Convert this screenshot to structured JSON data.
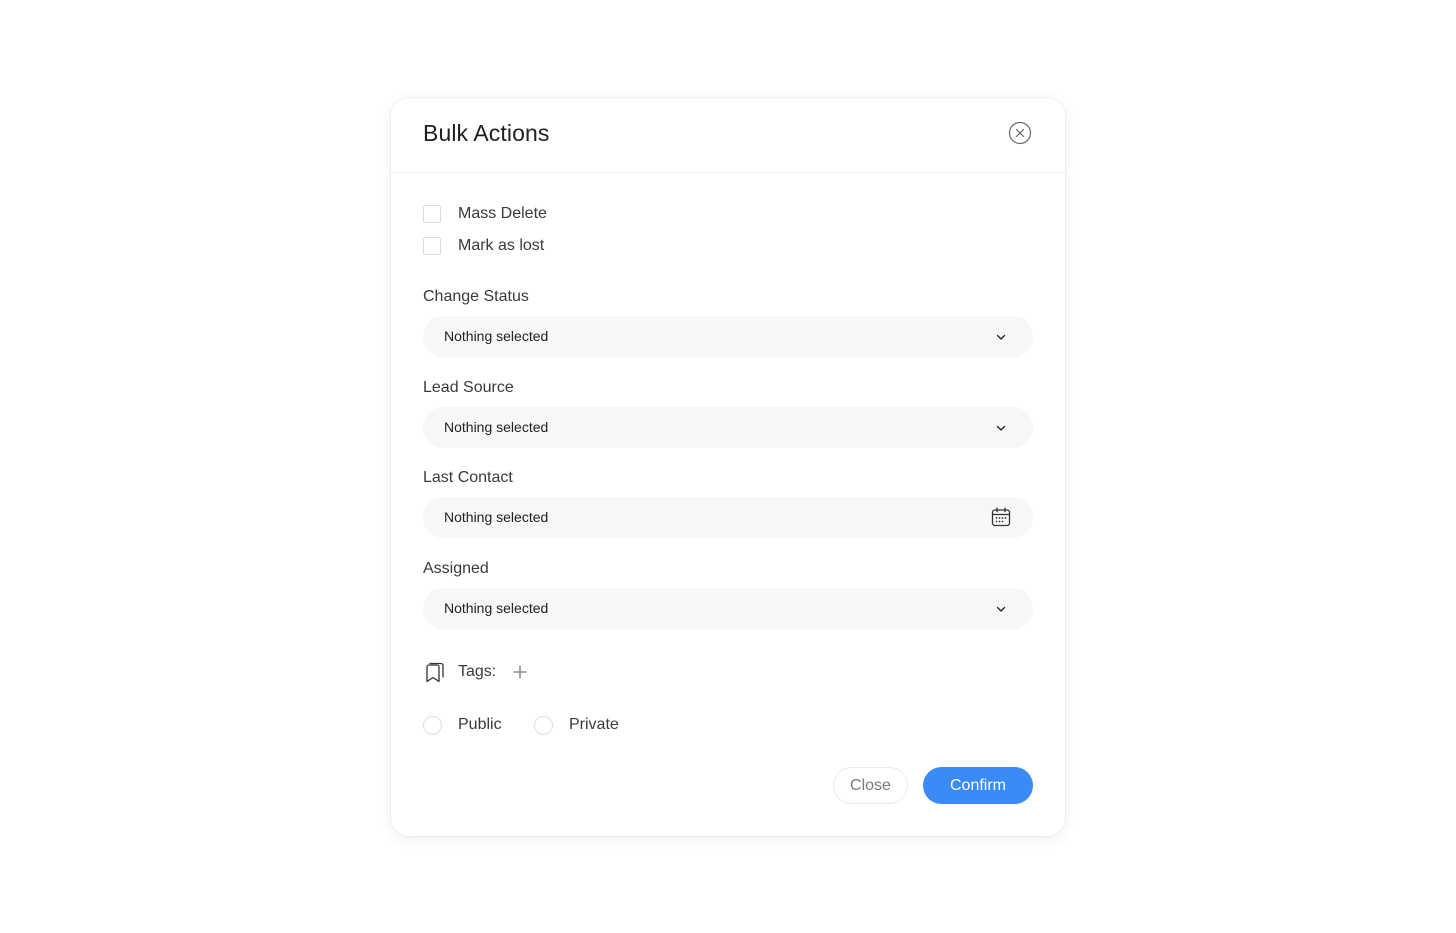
{
  "modal": {
    "title": "Bulk Actions"
  },
  "checkboxes": [
    {
      "label": "Mass Delete",
      "checked": false
    },
    {
      "label": "Mark as lost",
      "checked": false
    }
  ],
  "fields": {
    "change_status": {
      "label": "Change Status",
      "value": "Nothing selected"
    },
    "lead_source": {
      "label": "Lead Source",
      "value": "Nothing selected"
    },
    "last_contact": {
      "label": "Last Contact",
      "value": "Nothing selected"
    },
    "assigned": {
      "label": "Assigned",
      "value": "Nothing selected"
    }
  },
  "tags": {
    "label": "Tags:"
  },
  "visibility": {
    "options": [
      {
        "label": "Public",
        "selected": false
      },
      {
        "label": "Private",
        "selected": false
      }
    ]
  },
  "footer": {
    "close_label": "Close",
    "confirm_label": "Confirm"
  },
  "colors": {
    "primary": "#3a8bf6",
    "field_bg": "#f7f7f7",
    "control_border": "#dcdcdc"
  }
}
